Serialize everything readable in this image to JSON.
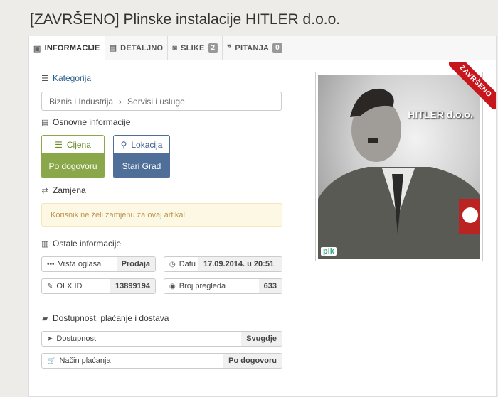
{
  "page_title": "[ZAVRŠENO] Plinske instalacije HITLER d.o.o.",
  "tabs": [
    {
      "label": "INFORMACIJE",
      "icon": "card-icon"
    },
    {
      "label": "DETALJNO",
      "icon": "document-icon"
    },
    {
      "label": "SLIKE",
      "icon": "camera-icon",
      "badge": "2"
    },
    {
      "label": "PITANJA",
      "icon": "comments-icon",
      "badge": "0"
    }
  ],
  "category": {
    "heading": "Kategorija",
    "breadcrumb": [
      "Biznis i Industrija",
      "Servisi i usluge"
    ]
  },
  "basic_info": {
    "heading": "Osnovne informacije",
    "price": {
      "label": "Cijena",
      "value": "Po dogovoru"
    },
    "location": {
      "label": "Lokacija",
      "value": "Stari Grad"
    }
  },
  "exchange": {
    "heading": "Zamjena",
    "message": "Korisnik ne želi zamjenu za ovaj artikal."
  },
  "other_info": {
    "heading": "Ostale informacije",
    "ad_type": {
      "label": "Vrsta oglasa",
      "value": "Prodaja"
    },
    "date": {
      "label": "Datu",
      "value": "17.09.2014. u 20:51"
    },
    "olx_id": {
      "label": "OLX ID",
      "value": "13899194"
    },
    "views": {
      "label": "Broj pregleda",
      "value": "633"
    }
  },
  "delivery": {
    "heading": "Dostupnost, plaćanje i dostava",
    "availability": {
      "label": "Dostupnost",
      "value": "Svugdje"
    },
    "payment": {
      "label": "Način plaćanja",
      "value": "Po dogovoru"
    }
  },
  "photo": {
    "caption": "HITLER d.o.o.",
    "ribbon": "ZAVRŠENO",
    "watermark": "pik"
  },
  "colors": {
    "ribbon": "#c8161d",
    "price_green": "#8aa84a",
    "location_blue": "#4f6f99",
    "alert_text": "#c09553"
  }
}
